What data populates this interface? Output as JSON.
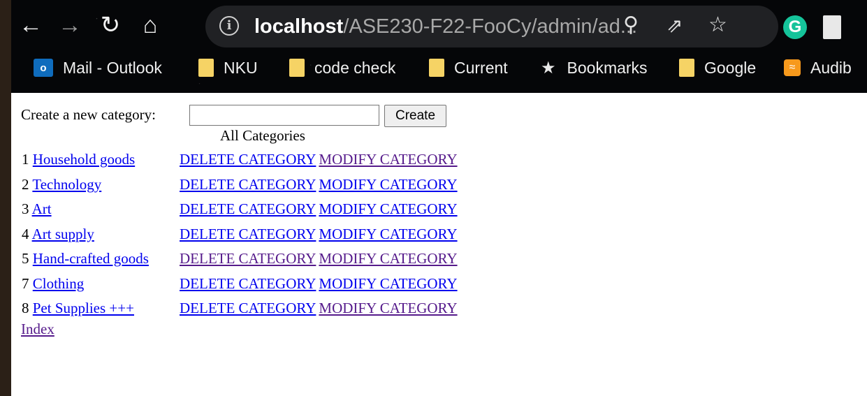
{
  "browser": {
    "url_host": "localhost",
    "url_path": "/ASE230-F22-FooCy/admin/ad...",
    "bookmarks": [
      {
        "label": "Mail - Outlook",
        "icon": "outlook-icon"
      },
      {
        "label": "NKU",
        "icon": "folder-icon"
      },
      {
        "label": "code check",
        "icon": "folder-icon"
      },
      {
        "label": "Current",
        "icon": "folder-icon"
      },
      {
        "label": "Bookmarks",
        "icon": "star-icon"
      },
      {
        "label": "Google",
        "icon": "folder-icon"
      },
      {
        "label": "Audib",
        "icon": "audible-icon"
      }
    ],
    "extension_letter": "G"
  },
  "page": {
    "create_label": "Create a new category:",
    "create_input_value": "",
    "create_button": "Create",
    "table_caption": "All Categories",
    "categories": [
      {
        "id": "1",
        "name": "Household goods",
        "delete": "DELETE CATEGORY",
        "modify": "MODIFY CATEGORY"
      },
      {
        "id": "2",
        "name": "Technology",
        "delete": "DELETE CATEGORY",
        "modify": "MODIFY CATEGORY"
      },
      {
        "id": "3",
        "name": "Art",
        "delete": "DELETE CATEGORY",
        "modify": "MODIFY CATEGORY"
      },
      {
        "id": "4",
        "name": "Art supply",
        "delete": "DELETE CATEGORY",
        "modify": "MODIFY CATEGORY"
      },
      {
        "id": "5",
        "name": "Hand-crafted goods",
        "delete": "DELETE CATEGORY",
        "modify": "MODIFY CATEGORY"
      },
      {
        "id": "7",
        "name": "Clothing",
        "delete": "DELETE CATEGORY",
        "modify": "MODIFY CATEGORY"
      },
      {
        "id": "8",
        "name": "Pet Supplies +++",
        "delete": "DELETE CATEGORY",
        "modify": "MODIFY CATEGORY"
      }
    ],
    "index_link": "Index"
  },
  "colors": {
    "link": "#0000ee",
    "visited_link": "#551a8b",
    "chrome_bg": "#050608",
    "omnibox_bg": "#202124"
  }
}
